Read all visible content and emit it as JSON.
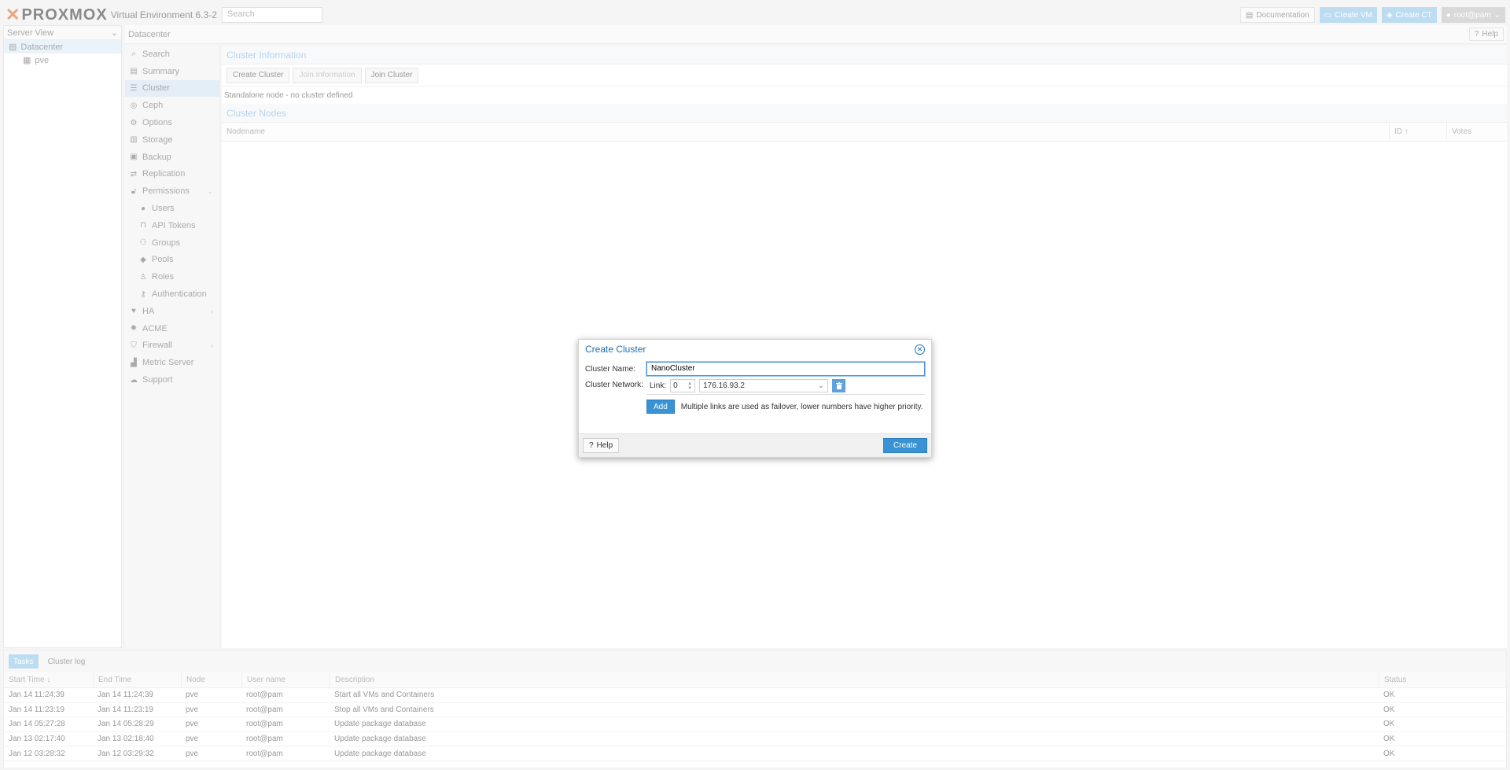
{
  "app": {
    "logo_text": "PROXMOX",
    "version": "Virtual Environment 6.3-2",
    "search_placeholder": "Search",
    "documentation_label": "Documentation",
    "create_vm_label": "Create VM",
    "create_ct_label": "Create CT",
    "user_label": "root@pam"
  },
  "tree": {
    "view_label": "Server View",
    "items": [
      {
        "label": "Datacenter"
      },
      {
        "label": "pve"
      }
    ]
  },
  "header": {
    "title": "Datacenter",
    "help_label": "Help"
  },
  "nav": {
    "items": [
      {
        "label": "Search",
        "icon": "search-icon"
      },
      {
        "label": "Summary",
        "icon": "book-icon"
      },
      {
        "label": "Cluster",
        "icon": "list-icon"
      },
      {
        "label": "Ceph",
        "icon": "ceph-icon"
      },
      {
        "label": "Options",
        "icon": "gear-icon"
      },
      {
        "label": "Storage",
        "icon": "database-icon"
      },
      {
        "label": "Backup",
        "icon": "floppy-icon"
      },
      {
        "label": "Replication",
        "icon": "retweet-icon"
      },
      {
        "label": "Permissions",
        "icon": "unlock-icon"
      },
      {
        "label": "Users",
        "icon": "user-icon"
      },
      {
        "label": "API Tokens",
        "icon": "lock-icon"
      },
      {
        "label": "Groups",
        "icon": "users-icon"
      },
      {
        "label": "Pools",
        "icon": "tags-icon"
      },
      {
        "label": "Roles",
        "icon": "male-icon"
      },
      {
        "label": "Authentication",
        "icon": "key-icon"
      },
      {
        "label": "HA",
        "icon": "heartbeat-icon"
      },
      {
        "label": "ACME",
        "icon": "certificate-icon"
      },
      {
        "label": "Firewall",
        "icon": "shield-icon"
      },
      {
        "label": "Metric Server",
        "icon": "chart-icon"
      },
      {
        "label": "Support",
        "icon": "comments-icon"
      }
    ]
  },
  "cluster": {
    "info_title": "Cluster Information",
    "create_cluster": "Create Cluster",
    "join_information": "Join Information",
    "join_cluster": "Join Cluster",
    "standalone_text": "Standalone node - no cluster defined",
    "nodes_title": "Cluster Nodes",
    "columns": {
      "nodename": "Nodename",
      "id": "ID",
      "votes": "Votes"
    }
  },
  "tasks": {
    "tab_tasks": "Tasks",
    "tab_log": "Cluster log",
    "columns": {
      "start": "Start Time",
      "end": "End Time",
      "node": "Node",
      "user": "User name",
      "desc": "Description",
      "status": "Status"
    },
    "rows": [
      {
        "start": "Jan 14 11:24:39",
        "end": "Jan 14 11:24:39",
        "node": "pve",
        "user": "root@pam",
        "desc": "Start all VMs and Containers",
        "status": "OK"
      },
      {
        "start": "Jan 14 11:23:19",
        "end": "Jan 14 11:23:19",
        "node": "pve",
        "user": "root@pam",
        "desc": "Stop all VMs and Containers",
        "status": "OK"
      },
      {
        "start": "Jan 14 05:27:28",
        "end": "Jan 14 05:28:29",
        "node": "pve",
        "user": "root@pam",
        "desc": "Update package database",
        "status": "OK"
      },
      {
        "start": "Jan 13 02:17:40",
        "end": "Jan 13 02:18:40",
        "node": "pve",
        "user": "root@pam",
        "desc": "Update package database",
        "status": "OK"
      },
      {
        "start": "Jan 12 03:28:32",
        "end": "Jan 12 03:29:32",
        "node": "pve",
        "user": "root@pam",
        "desc": "Update package database",
        "status": "OK"
      }
    ]
  },
  "dialog": {
    "title": "Create Cluster",
    "cluster_name_label": "Cluster Name:",
    "cluster_name_value": "NanoCluster",
    "network_label": "Cluster Network:",
    "link_label": "Link:",
    "link_value": "0",
    "address_value": "176.16.93.2",
    "add_label": "Add",
    "hint": "Multiple links are used as failover, lower numbers have higher priority.",
    "help_label": "Help",
    "create_label": "Create"
  },
  "colors": {
    "accent": "#3892d4",
    "title_blue": "#1b6fb5"
  }
}
